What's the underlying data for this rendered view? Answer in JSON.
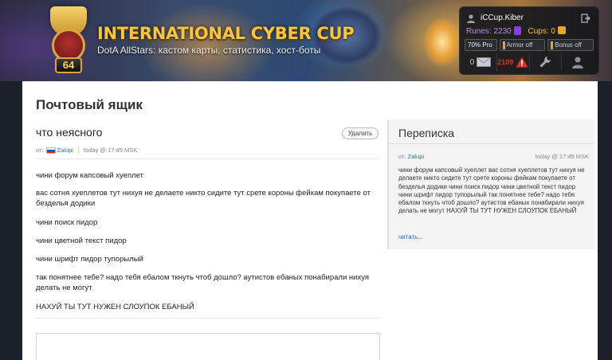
{
  "header": {
    "site_title": "INTERNATIONAL CYBER CUP",
    "site_subtitle": "DotA AllStars: кастом карты, статистика, хост-боты",
    "level": "64"
  },
  "user_panel": {
    "username": "iCCup.Kiber",
    "runes_label": "Runes: 2230",
    "cups_label": "Cups: 0",
    "pro_label": "70% Pro",
    "armor_label": "Armor off",
    "bonus_label": "Bonus off",
    "mail_count": "0",
    "alert_count": "2109"
  },
  "page": {
    "title": "Почтовый ящик"
  },
  "message": {
    "subject": "что неясного",
    "delete_label": "Удалить",
    "from_label": "от:",
    "author": "Zalupi",
    "date": "today @ 17:49 MSK",
    "lines": [
      "чини форум капсовый хуеплет",
      "вас сотня хуеплетов тут нихуя не делаете никто сидите тут срете короны фейкам покупаете от безделья додики",
      "чини поиск пидор",
      "чини цветной текст пидор",
      "чини шрифт пидор тупорылый",
      "так понятнее тебе? надо тебя ебалом ткнуть чтоб дошло? аутистов ебаных понабирали нихуя делать не могут",
      "НАХУЙ ТЫ ТУТ НУЖЕН СЛОУПОК ЕБАНЫЙ"
    ]
  },
  "sidebar": {
    "title": "Переписка",
    "from_label": "от:",
    "author": "Zalupi",
    "date": "today @ 17:49 MSK",
    "preview": "чини форум капсовый хуеплет вас сотня хуеплетов тут нихуя не делаете никто сидите тут срете короны фейкам покупаете от безделья додики чини поиск пидор чини цветной текст пидор чини шрифт пидор тупорылый так понятнее тебе? надо тебя ебалом ткнуть чтоб дошло? аутистов ебаных понабирали нихуя делать не могут НАХУЙ ТЫ ТУТ НУЖЕН СЛОУПОК ЕБАНЫЙ",
    "read_more": "читать..."
  },
  "colors": {
    "accent_gold": "#f5c542",
    "runes_purple": "#b48cf2",
    "link_blue": "#2a6cc4",
    "alert_red": "#e03030"
  },
  "icons": {
    "user": "user-icon",
    "logout": "logout-icon",
    "mail": "envelope-icon",
    "alert": "warning-icon",
    "tools": "wrench-icon",
    "profile": "profile-icon"
  }
}
